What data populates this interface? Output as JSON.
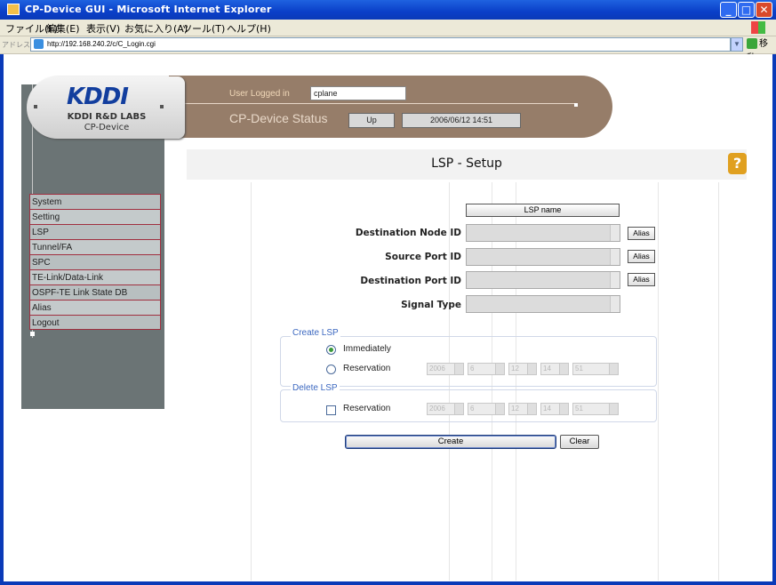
{
  "window": {
    "title": "CP-Device GUI - Microsoft Internet Explorer"
  },
  "menu": [
    "ファイル(F)",
    "編集(E)",
    "表示(V)",
    "お気に入り(A)",
    "ツール(T)",
    "ヘルプ(H)"
  ],
  "address": {
    "label": "アドレス(D)",
    "url": "http://192.168.240.2/c/C_Login.cgi",
    "go": "移動"
  },
  "header": {
    "logo": "KDDI",
    "logo_line1": "KDDI R&D LABS",
    "logo_line2": "CP-Device",
    "user_label": "User Logged in",
    "user_value": "cplane",
    "status_label": "CP-Device Status",
    "status_value": "Up",
    "status_time": "2006/06/12 14:51"
  },
  "nav": [
    "System",
    "Setting",
    "LSP",
    "Tunnel/FA",
    "SPC",
    "TE-Link/Data-Link",
    "OSPF-TE Link State DB",
    "Alias",
    "Logout"
  ],
  "page": {
    "title": "LSP - Setup",
    "help_icon": "?",
    "lsp_name_button": "LSP name",
    "fields": {
      "dest_node": "Destination Node ID",
      "source_port": "Source Port ID",
      "dest_port": "Destination Port ID",
      "signal_type": "Signal Type"
    },
    "alias": "Alias",
    "create_lsp": {
      "legend": "Create LSP",
      "immediately": "Immediately",
      "reservation": "Reservation",
      "year": "2006",
      "month": "6",
      "day": "12",
      "hour": "14",
      "minute": "51"
    },
    "delete_lsp": {
      "legend": "Delete LSP",
      "reservation": "Reservation",
      "year": "2006",
      "month": "6",
      "day": "12",
      "hour": "14",
      "minute": "51"
    },
    "create_button": "Create",
    "clear_button": "Clear"
  },
  "colors": {
    "banner": "#967d69",
    "sidebar": "#6b7475",
    "nav_border": "#a03040",
    "legend": "#3c68c0"
  }
}
